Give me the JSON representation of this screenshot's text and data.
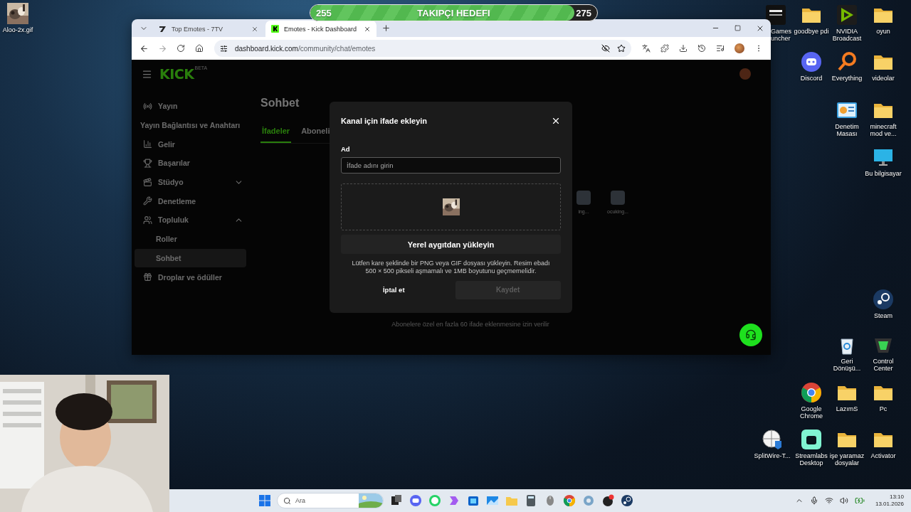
{
  "goal_bar": {
    "start": "255",
    "title": "TAKIPÇI HEDEFI",
    "end": "275",
    "level": 0.92
  },
  "desktop_icons": [
    {
      "label": "Aloo-2x.gif"
    },
    {
      "label": "Games uncher"
    },
    {
      "label": "goodbye pdi"
    },
    {
      "label": "NVIDIA Broadcast"
    },
    {
      "label": "oyun"
    },
    {
      "label": "Discord"
    },
    {
      "label": "Everything"
    },
    {
      "label": "videolar"
    },
    {
      "label": "Denetim Masası"
    },
    {
      "label": "minecraft mod ve..."
    },
    {
      "label": "Bu bilgisayar"
    },
    {
      "label": "Steam"
    },
    {
      "label": "Geri Dönüşü..."
    },
    {
      "label": "Control Center"
    },
    {
      "label": "Google Chrome"
    },
    {
      "label": "LazımS"
    },
    {
      "label": "Pc"
    },
    {
      "label": "SplitWire-T..."
    },
    {
      "label": "Streamlabs Desktop"
    },
    {
      "label": "işe yaramaz dosyalar"
    },
    {
      "label": "Activator"
    }
  ],
  "browser": {
    "tabs": [
      {
        "title": "Top Emotes - 7TV",
        "selected": false
      },
      {
        "title": "Emotes - Kick Dashboard",
        "selected": true
      }
    ],
    "url_host": "dashboard.kick.com",
    "url_path": "/community/chat/emotes"
  },
  "page": {
    "logo": "KICK",
    "logo_badge": "BETA",
    "sidebar": {
      "items": [
        {
          "label": "Yayın",
          "kind": "link",
          "selected": false,
          "children": [
            {
              "label": "Yayın Bağlantısı ve Anahtarı",
              "selected": false
            }
          ]
        },
        {
          "label": "Gelir",
          "kind": "link",
          "selected": false
        },
        {
          "label": "Başarılar",
          "kind": "link",
          "selected": false
        },
        {
          "label": "Stüdyo",
          "kind": "group",
          "expanded": false,
          "selected": false
        },
        {
          "label": "Denetleme",
          "kind": "link",
          "selected": false
        },
        {
          "label": "Topluluk",
          "kind": "group",
          "expanded": true,
          "selected": false,
          "children": [
            {
              "label": "Roller",
              "selected": false
            },
            {
              "label": "Sohbet",
              "selected": true
            }
          ]
        },
        {
          "label": "Droplar ve ödüller",
          "kind": "link",
          "selected": false
        }
      ]
    },
    "heading": "Sohbet",
    "tabs": [
      {
        "label": "İfadeler",
        "selected": true
      },
      {
        "label": "Aboneli",
        "selected": false
      }
    ],
    "emotes": [
      {
        "name": "ing..."
      },
      {
        "name": "ocuking..."
      }
    ],
    "note": "Abonelere özel en fazla 60 ifade eklenmesine izin verilir"
  },
  "dialog": {
    "title": "Kanal için ifade ekleyin",
    "field_label": "Ad",
    "placeholder": "İfade adını girin",
    "upload_button": "Yerel aygıtdan yükleyin",
    "hint": "Lütfen kare şeklinde bir PNG veya GIF dosyası yükleyin. Resim ebadı 500 × 500 pikseli aşmamalı ve 1MB boyutunu geçmemelidir.",
    "cancel": "İptal et",
    "save": {
      "label": "Kaydet",
      "disabled": true
    }
  },
  "taskbar": {
    "search_placeholder": "Ara",
    "time": "13:10",
    "date": "13.01.2026"
  }
}
